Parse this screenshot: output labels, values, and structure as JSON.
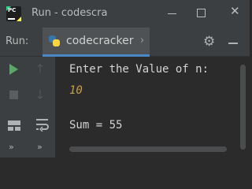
{
  "window": {
    "title": "Run - codescra",
    "app_icon": "pycharm-logo",
    "app_icon_text": "PC"
  },
  "run_panel": {
    "label": "Run:",
    "tab": {
      "label": "codecracker",
      "icon": "python-icon",
      "chevron": "›"
    },
    "settings_icon": "gear-icon",
    "minimize_icon": "minimize-icon"
  },
  "toolbar": {
    "rerun_icon": "play-icon",
    "up_icon": "up-arrow-icon",
    "stop_icon": "stop-icon",
    "down_icon": "down-arrow-icon",
    "layout_icon": "layout-icon",
    "soft_wrap_icon": "soft-wrap-icon",
    "more_glyph": "»"
  },
  "console": {
    "prompt": "Enter the Value of n:",
    "input": "10",
    "result": "Sum = 55"
  },
  "colors": {
    "background": "#2b2b2b",
    "panel": "#3c3f41",
    "run_green": "#59a869",
    "input_text": "#c7a04a",
    "tab_underline": "#4a88c7"
  }
}
